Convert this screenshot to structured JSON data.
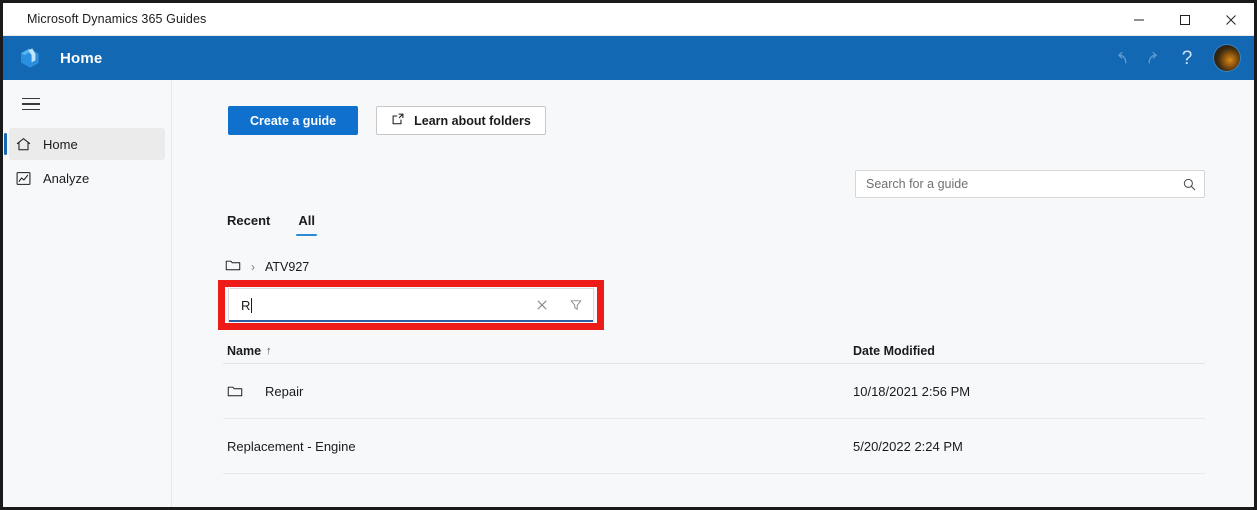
{
  "window": {
    "title": "Microsoft Dynamics 365 Guides",
    "controls": {
      "minimize": "minimize-icon",
      "maximize": "maximize-icon",
      "close": "close-icon"
    }
  },
  "header": {
    "logo_icon": "dynamics-guides-logo-icon",
    "title": "Home",
    "undo_icon": "undo-icon",
    "redo_icon": "redo-icon",
    "help_label": "?",
    "avatar": "user-avatar",
    "background_color": "#1268b3"
  },
  "sidebar": {
    "menu_icon": "hamburger-menu-icon",
    "items": [
      {
        "label": "Home",
        "icon": "home-icon",
        "selected": true
      },
      {
        "label": "Analyze",
        "icon": "analyze-chart-icon",
        "selected": false
      }
    ],
    "selected_indicator_color": "#1268b3"
  },
  "toolbar": {
    "create_guide_label": "Create a guide",
    "learn_folders_label": "Learn about folders",
    "learn_folders_icon": "open-in-new-icon",
    "primary_color": "#0f70cd"
  },
  "search": {
    "placeholder": "Search for a guide",
    "value": "",
    "icon": "search-icon"
  },
  "tabs": [
    {
      "label": "Recent",
      "active": false
    },
    {
      "label": "All",
      "active": true
    }
  ],
  "breadcrumb": {
    "folder_icon": "folder-icon",
    "separator": "›",
    "path": "ATV927"
  },
  "filter": {
    "value": "R",
    "placeholder": "",
    "clear_icon": "clear-x-icon",
    "filter_icon": "filter-funnel-icon",
    "highlight_color": "#ee1c19",
    "focus_underline_color": "#2f5fa0"
  },
  "table": {
    "columns": [
      {
        "label": "Name",
        "sort": "↑"
      },
      {
        "label": "Date Modified",
        "sort": ""
      }
    ],
    "rows": [
      {
        "icon": "folder-icon",
        "name": "Repair",
        "date_modified": "10/18/2021 2:56 PM"
      },
      {
        "icon": "",
        "name": "Replacement - Engine",
        "date_modified": "5/20/2022 2:24 PM"
      }
    ]
  }
}
